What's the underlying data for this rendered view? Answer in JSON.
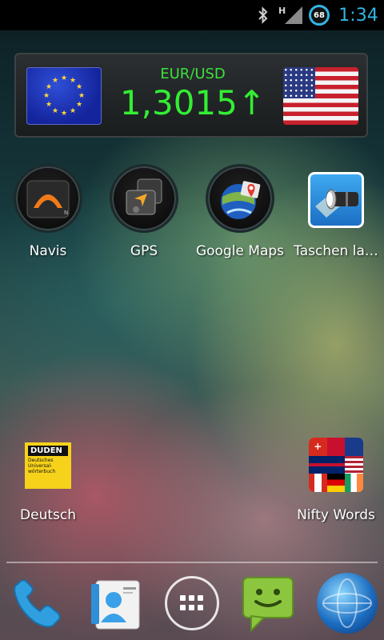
{
  "status_bar": {
    "time": "1:34",
    "battery_level": "68",
    "network_type": "H",
    "icons": [
      "bluetooth-icon",
      "signal-icon",
      "battery-icon"
    ],
    "accent_color": "#33b5e5"
  },
  "widget": {
    "pair": "EUR/USD",
    "rate": "1,3015",
    "trend": "↑",
    "text_color": "#33ee33"
  },
  "apps_row1": [
    {
      "label": "Navis",
      "icon": "navigation-icon"
    },
    {
      "label": "GPS",
      "icon": "gps-icon"
    },
    {
      "label": "Google Maps",
      "icon": "google-maps-icon"
    },
    {
      "label": "Taschen la…",
      "icon": "flashlight-icon"
    }
  ],
  "apps_row2": [
    {
      "label": "Deutsch",
      "icon": "duden-dictionary-icon",
      "icon_text": "DUDEN",
      "icon_subtext": "Deutsches Universal-wörterbuch"
    },
    {
      "label": "Nifty Words",
      "icon": "nifty-words-flags-icon"
    }
  ],
  "dock": [
    {
      "name": "phone",
      "icon": "phone-icon"
    },
    {
      "name": "contacts",
      "icon": "contacts-icon"
    },
    {
      "name": "app-drawer",
      "icon": "app-drawer-icon"
    },
    {
      "name": "messaging",
      "icon": "messaging-icon"
    },
    {
      "name": "browser",
      "icon": "browser-globe-icon"
    }
  ]
}
